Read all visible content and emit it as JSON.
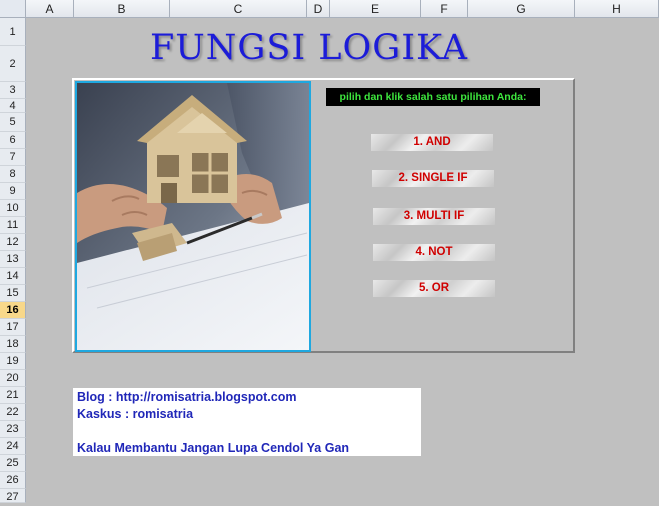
{
  "columns": [
    "A",
    "B",
    "C",
    "D",
    "E",
    "F",
    "G",
    "H"
  ],
  "rows": [
    "1",
    "2",
    "3",
    "4",
    "5",
    "6",
    "7",
    "8",
    "9",
    "10",
    "11",
    "12",
    "13",
    "14",
    "15",
    "16",
    "17",
    "18",
    "19",
    "20",
    "21",
    "22",
    "23",
    "24",
    "25",
    "26",
    "27"
  ],
  "active_row": "16",
  "title": "FUNGSI LOGIKA",
  "instruction": "pilih dan klik salah satu pilihan Anda:",
  "options": [
    "1. AND",
    "2. SINGLE IF",
    "3. MULTI IF",
    "4. NOT",
    "5. OR"
  ],
  "info": {
    "blog": "Blog : http://romisatria.blogspot.com",
    "kaskus": "Kaskus : romisatria",
    "blank": "",
    "message": "Kalau Membantu Jangan Lupa Cendol Ya Gan"
  },
  "colors": {
    "title": "#1c1cd8",
    "instruction_text": "#3ee63e",
    "option_text": "#d00000",
    "info_text": "#2027b8",
    "photo_border": "#1fa8e0"
  },
  "icons": {
    "photo": "architect-house-model-photo"
  }
}
